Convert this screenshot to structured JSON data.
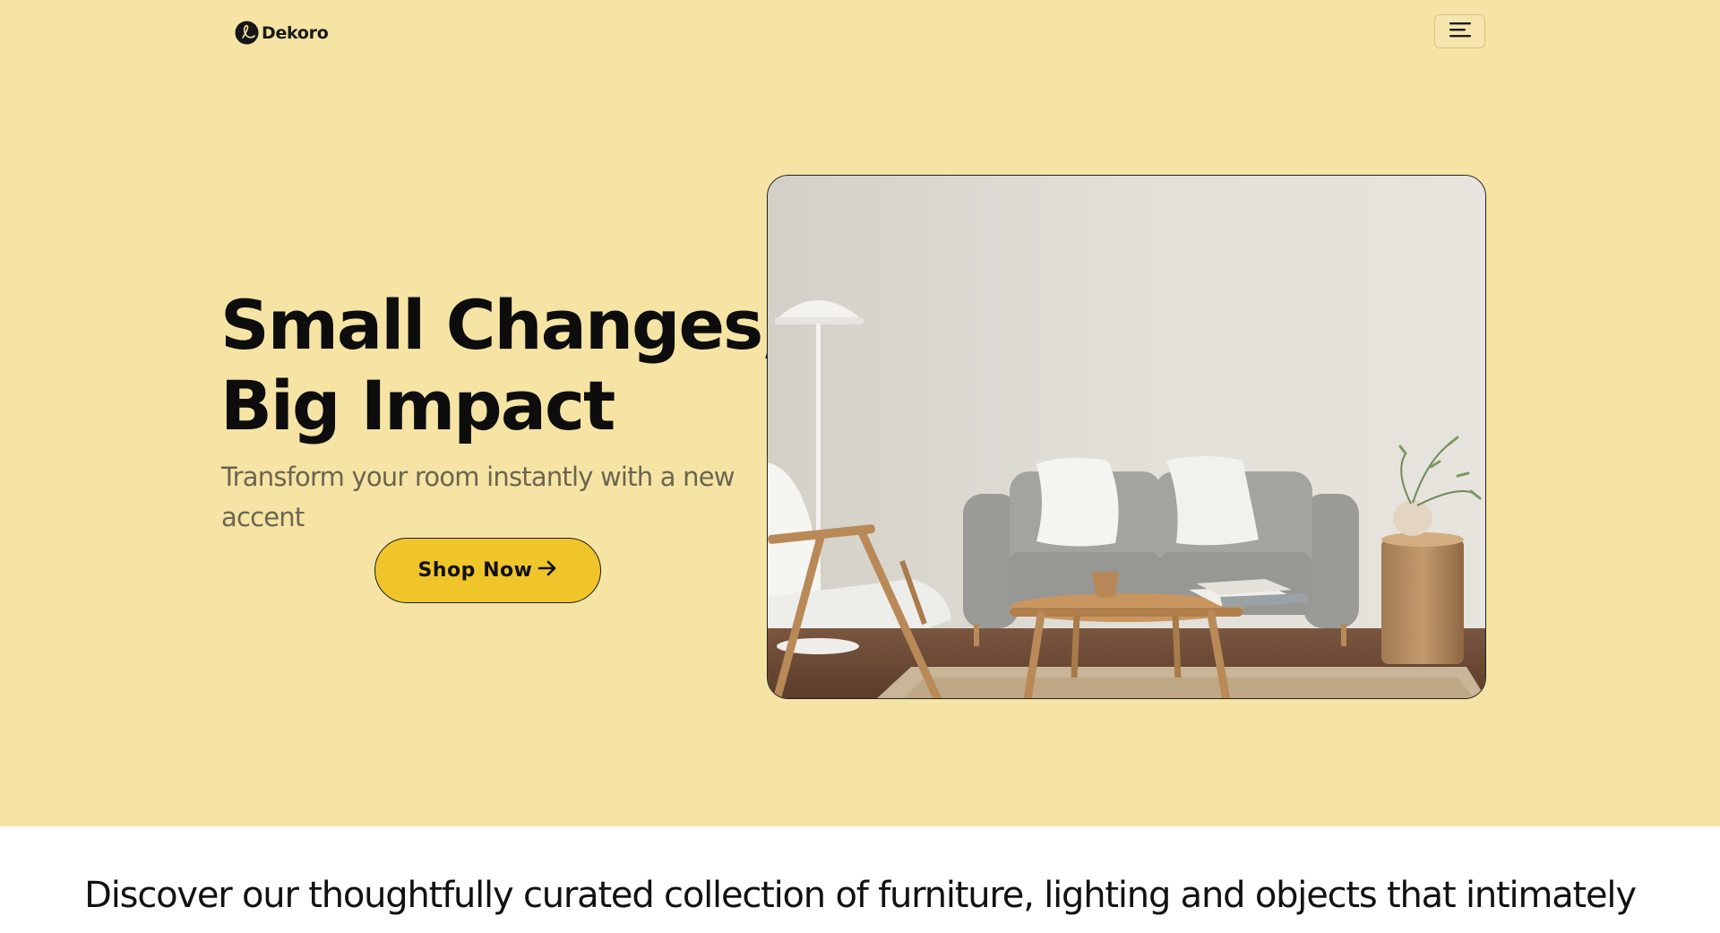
{
  "brand": {
    "name": "Dekoro",
    "logo_icon": "dekoro-logo-icon"
  },
  "nav": {
    "menu_icon": "hamburger-menu-icon"
  },
  "hero": {
    "headline_line1": "Small Changes,",
    "headline_line2": "Big Impact",
    "subtext": "Transform your room instantly with a new accent",
    "cta_label": "Shop Now",
    "cta_icon": "arrow-right-icon",
    "image_subject": "living-room-sofa-photo"
  },
  "intro": {
    "text": "Discover our thoughtfully curated collection of furniture, lighting and objects that intimately"
  },
  "colors": {
    "hero_background": "#f6e4a4",
    "cta_background": "#f0c52a",
    "text_primary": "#0d0d0d",
    "text_muted": "#6b6550"
  }
}
